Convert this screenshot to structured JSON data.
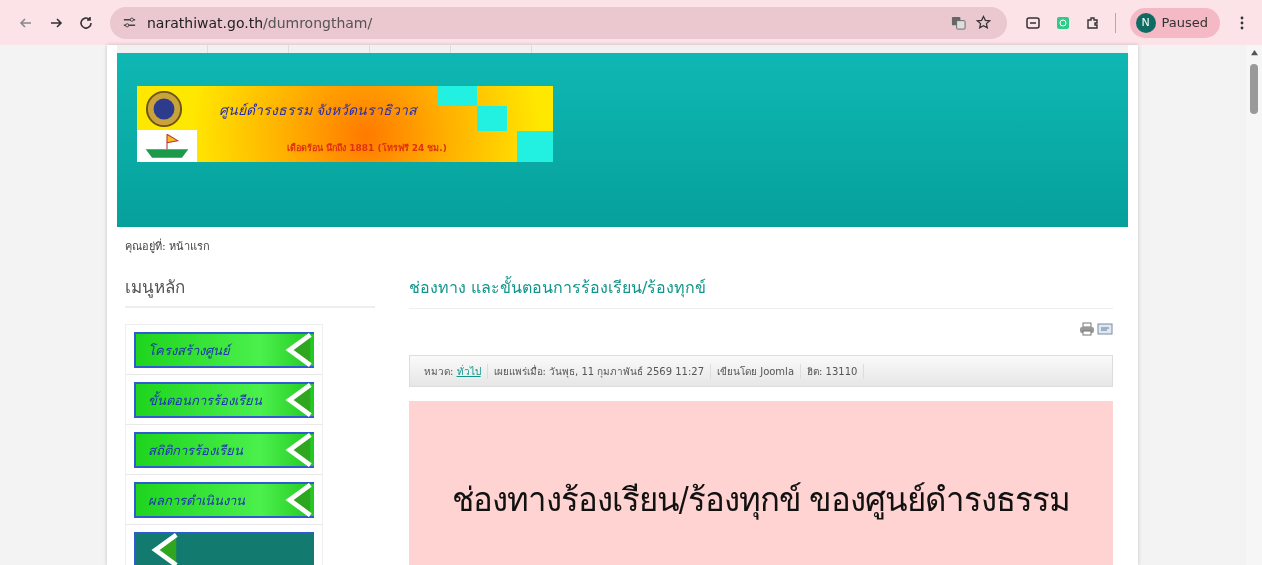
{
  "browser": {
    "url_host": "narathiwat.go.th",
    "url_path": "/dumrongtham/",
    "profile_initial": "N",
    "profile_status": "Paused"
  },
  "banner": {
    "title": "ศูนย์ดำรงธรรม จังหวัดนราธิวาส",
    "subtitle": "เดือดร้อน นึกถึง 1881 (โทรฟรี 24 ชม.)"
  },
  "breadcrumb": {
    "label": "คุณอยู่ที่:",
    "current": "หน้าแรก"
  },
  "sidebar": {
    "title": "เมนูหลัก",
    "items": [
      {
        "kind": "labeled",
        "label": "โครงสร้างศูนย์"
      },
      {
        "kind": "labeled",
        "label": "ขั้นตอนการร้องเรียน"
      },
      {
        "kind": "labeled",
        "label": "สถิติการร้องเรียน"
      },
      {
        "kind": "labeled",
        "label": "ผลการดำเนินงาน"
      },
      {
        "kind": "cut"
      }
    ]
  },
  "article": {
    "title": "ช่องทาง และขั้นตอนการร้องเรียน/ร้องทุกข์",
    "info": [
      {
        "kind": "category",
        "label": "หมวด:",
        "value": "ทั่วไป"
      },
      {
        "kind": "text",
        "label": "เผยแพร่เมื่อ: วันพุธ, 11 กุมภาพันธ์ 2569 11:27"
      },
      {
        "kind": "text",
        "label": "เขียนโดย Joomla"
      },
      {
        "kind": "text",
        "label": "ฮิต: 13110"
      }
    ],
    "poster_heading": "ช่องทางร้องเรียน/ร้องทุกข์ ของศูนย์ดำรงธรรม"
  }
}
